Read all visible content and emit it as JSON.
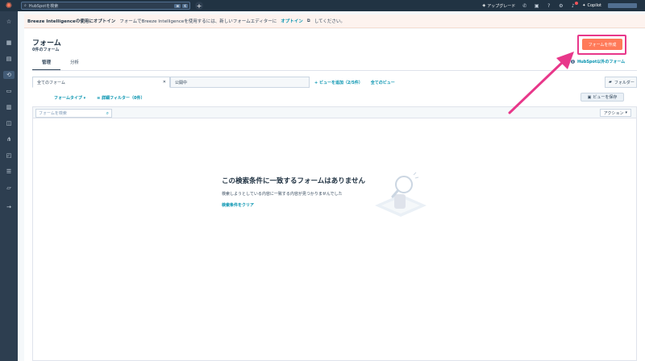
{
  "topbar": {
    "search_placeholder": "HubSpotを検索",
    "kbd1": "⌘",
    "kbd2": "K",
    "upgrade": "アップグレード",
    "copilot": "Copilot"
  },
  "banner": {
    "title": "Breeze Intelligenceの使用にオプトイン",
    "text": "フォームでBreeze Intelligenceを使用するには、新しいフォームエディターに",
    "link": "オプトイン",
    "suffix": "してください。"
  },
  "page": {
    "title": "フォーム",
    "count": "0件のフォーム",
    "create_button": "フォームを作成",
    "other_forms": "HubSpot以外のフォーム"
  },
  "tabs": [
    "管理",
    "分析"
  ],
  "views": {
    "first": "全てのフォーム",
    "second": "公開中",
    "add_view": "ビューを追加（2/5件）",
    "all_views": "全てのビュー",
    "folder": "フォルダー"
  },
  "filters": {
    "form_type": "フォームタイプ",
    "advanced": "詳細フィルター（0件）",
    "save_view": "ビューを保存"
  },
  "table": {
    "search_placeholder": "フォームを検索",
    "actions": "アクション"
  },
  "empty": {
    "title": "この検索条件に一致するフォームはありません",
    "description": "検索しようとしている内容に一致する内容が見つかりませんでした",
    "clear": "検索条件をクリア"
  },
  "colors": {
    "accent": "#ff7a59",
    "highlight": "#e8378a",
    "link": "#0091ae",
    "nav": "#213343"
  }
}
